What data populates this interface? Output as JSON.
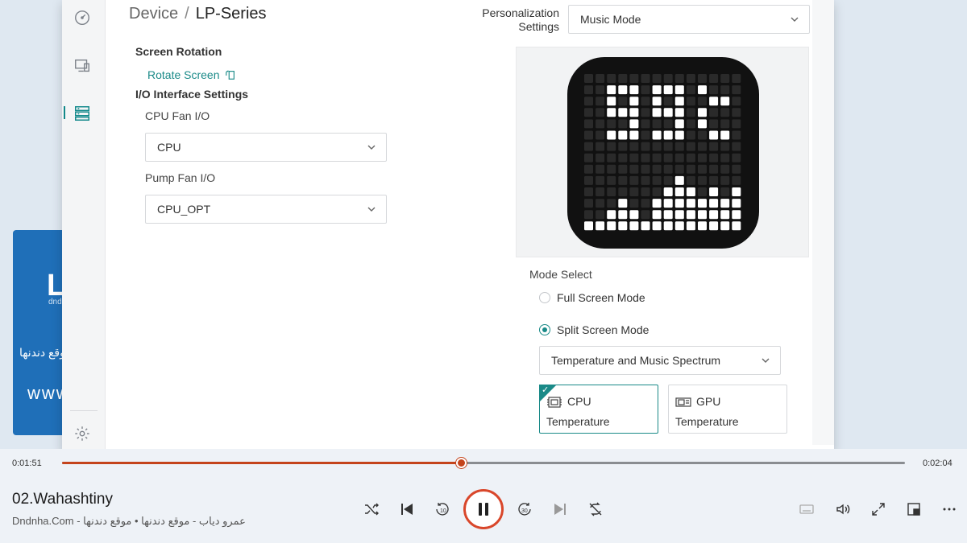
{
  "background_card": {
    "arabic_text": "موقع دندنها",
    "web_text": "www"
  },
  "app": {
    "breadcrumb": {
      "root": "Device",
      "separator": "/",
      "current": "LP-Series"
    },
    "nav": [
      "dashboard-icon",
      "monitor-icon",
      "device-list-icon",
      "settings-icon"
    ],
    "screen_rotation": {
      "label": "Screen Rotation",
      "link": "Rotate Screen"
    },
    "io_settings": {
      "label": "I/O Interface Settings",
      "cpu_fan": {
        "label": "CPU Fan I/O",
        "value": "CPU"
      },
      "pump_fan": {
        "label": "Pump Fan I/O",
        "value": "CPU_OPT"
      }
    },
    "personalization": {
      "label_line1": "Personalization",
      "label_line2": "Settings",
      "value": "Music Mode"
    },
    "mode_select": {
      "label": "Mode Select",
      "options": [
        "Full Screen Mode",
        "Split Screen Mode"
      ],
      "selected": "Split Screen Mode",
      "split_value": "Temperature and Music Spectrum"
    },
    "sensors": [
      {
        "line1": "CPU",
        "line2": "Temperature",
        "selected": true,
        "icon": "cpu-chip-icon"
      },
      {
        "line1": "GPU",
        "line2": "Temperature",
        "selected": false,
        "icon": "gpu-chip-icon"
      }
    ],
    "accent_color": "#1a8a88"
  },
  "player": {
    "elapsed": "0:01:51",
    "total": "0:02:04",
    "progress": 0.474,
    "title": "02.Wahashtiny",
    "artist": "Dndnha.Com - عمرو دياب - موقع دندنها • موقع دندنها",
    "accent_color": "#c4441c"
  }
}
